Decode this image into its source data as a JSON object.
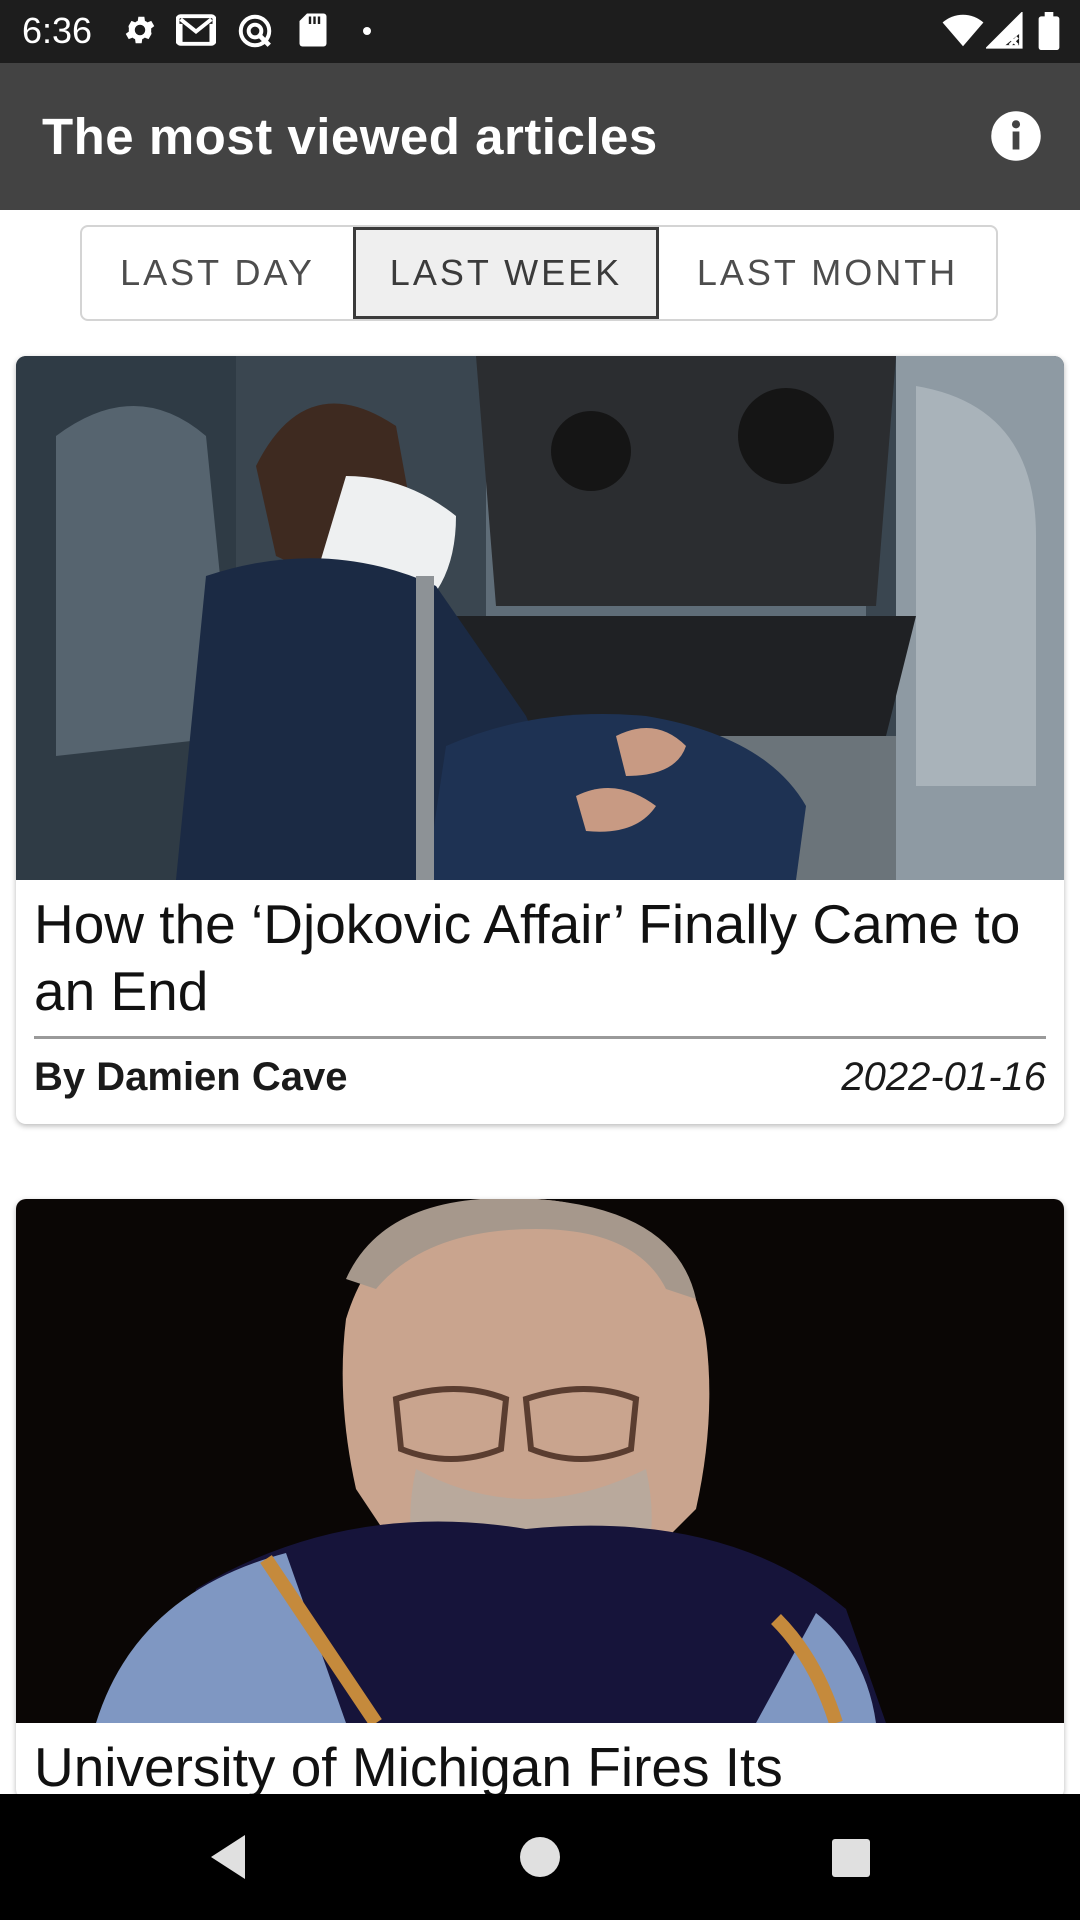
{
  "status_bar": {
    "time": "6:36",
    "left_icons": [
      "settings-icon",
      "gmail-icon",
      "vpn-icon",
      "sd-card-icon",
      "notification-dot-icon"
    ],
    "right_icons": [
      "wifi-icon",
      "cell-signal-icon",
      "battery-icon"
    ]
  },
  "app_bar": {
    "title": "The most viewed articles",
    "info_icon": "info-icon"
  },
  "tabs": [
    {
      "label": "LAST DAY",
      "selected": false
    },
    {
      "label": "LAST WEEK",
      "selected": true
    },
    {
      "label": "LAST MONTH",
      "selected": false
    }
  ],
  "articles": [
    {
      "title": "How the ‘Djokovic Affair’ Finally Came to an End",
      "byline": "By Damien Cave",
      "date": "2022-01-16",
      "image": "photo of masked man in car seat with photographers outside window"
    },
    {
      "title": "University of Michigan Fires Its",
      "image": "photo of bearded man with glasses in academic robe"
    }
  ],
  "nav_bar": {
    "buttons": [
      "back-icon",
      "home-icon",
      "recents-icon"
    ]
  },
  "colors": {
    "status_bar": "#1d1d1d",
    "app_bar": "#434343",
    "selected_tab_bg": "#efefef",
    "nav_bar": "#000000"
  }
}
